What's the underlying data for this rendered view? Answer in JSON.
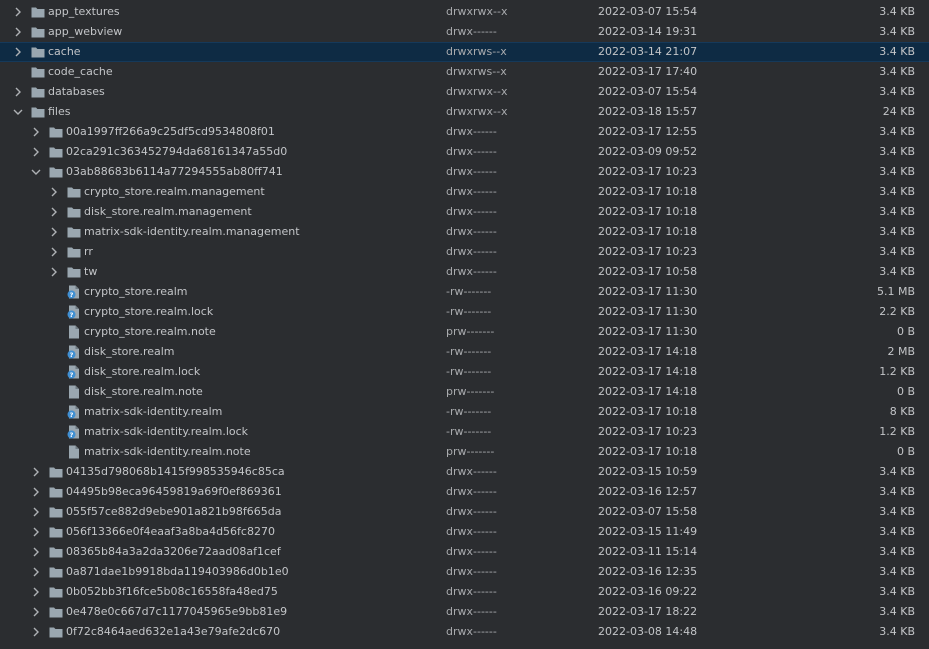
{
  "theme": {
    "background": "#2b2d30",
    "selection": "#0e2b44",
    "folder_color": "#9aa7b0",
    "file_color": "#9aa7b0",
    "unknown_badge": "#3f8fd2"
  },
  "rows": [
    {
      "depth": 0,
      "type": "folder",
      "arrow": "right",
      "name": "app_textures",
      "perm": "drwxrwx--x",
      "date": "2022-03-07 15:54",
      "size": "3.4 KB"
    },
    {
      "depth": 0,
      "type": "folder",
      "arrow": "right",
      "name": "app_webview",
      "perm": "drwx------",
      "date": "2022-03-14 19:31",
      "size": "3.4 KB"
    },
    {
      "depth": 0,
      "type": "folder",
      "arrow": "right",
      "name": "cache",
      "perm": "drwxrws--x",
      "date": "2022-03-14 21:07",
      "size": "3.4 KB",
      "selected": true
    },
    {
      "depth": 0,
      "type": "folder",
      "arrow": "none",
      "name": "code_cache",
      "perm": "drwxrws--x",
      "date": "2022-03-17 17:40",
      "size": "3.4 KB"
    },
    {
      "depth": 0,
      "type": "folder",
      "arrow": "right",
      "name": "databases",
      "perm": "drwxrwx--x",
      "date": "2022-03-07 15:54",
      "size": "3.4 KB"
    },
    {
      "depth": 0,
      "type": "folder",
      "arrow": "down",
      "name": "files",
      "perm": "drwxrwx--x",
      "date": "2022-03-18 15:57",
      "size": "24 KB"
    },
    {
      "depth": 1,
      "type": "folder",
      "arrow": "right",
      "name": "00a1997ff266a9c25df5cd9534808f01",
      "perm": "drwx------",
      "date": "2022-03-17 12:55",
      "size": "3.4 KB"
    },
    {
      "depth": 1,
      "type": "folder",
      "arrow": "right",
      "name": "02ca291c363452794da68161347a55d0",
      "perm": "drwx------",
      "date": "2022-03-09 09:52",
      "size": "3.4 KB"
    },
    {
      "depth": 1,
      "type": "folder",
      "arrow": "down",
      "name": "03ab88683b6114a77294555ab80ff741",
      "perm": "drwx------",
      "date": "2022-03-17 10:23",
      "size": "3.4 KB"
    },
    {
      "depth": 2,
      "type": "folder",
      "arrow": "right",
      "name": "crypto_store.realm.management",
      "perm": "drwx------",
      "date": "2022-03-17 10:18",
      "size": "3.4 KB"
    },
    {
      "depth": 2,
      "type": "folder",
      "arrow": "right",
      "name": "disk_store.realm.management",
      "perm": "drwx------",
      "date": "2022-03-17 10:18",
      "size": "3.4 KB"
    },
    {
      "depth": 2,
      "type": "folder",
      "arrow": "right",
      "name": "matrix-sdk-identity.realm.management",
      "perm": "drwx------",
      "date": "2022-03-17 10:18",
      "size": "3.4 KB"
    },
    {
      "depth": 2,
      "type": "folder",
      "arrow": "right",
      "name": "rr",
      "perm": "drwx------",
      "date": "2022-03-17 10:23",
      "size": "3.4 KB"
    },
    {
      "depth": 2,
      "type": "folder",
      "arrow": "right",
      "name": "tw",
      "perm": "drwx------",
      "date": "2022-03-17 10:58",
      "size": "3.4 KB"
    },
    {
      "depth": 2,
      "type": "unknown",
      "arrow": "none",
      "name": "crypto_store.realm",
      "perm": "-rw-------",
      "date": "2022-03-17 11:30",
      "size": "5.1 MB"
    },
    {
      "depth": 2,
      "type": "unknown",
      "arrow": "none",
      "name": "crypto_store.realm.lock",
      "perm": "-rw-------",
      "date": "2022-03-17 11:30",
      "size": "2.2 KB"
    },
    {
      "depth": 2,
      "type": "file",
      "arrow": "none",
      "name": "crypto_store.realm.note",
      "perm": "prw-------",
      "date": "2022-03-17 11:30",
      "size": "0 B"
    },
    {
      "depth": 2,
      "type": "unknown",
      "arrow": "none",
      "name": "disk_store.realm",
      "perm": "-rw-------",
      "date": "2022-03-17 14:18",
      "size": "2 MB"
    },
    {
      "depth": 2,
      "type": "unknown",
      "arrow": "none",
      "name": "disk_store.realm.lock",
      "perm": "-rw-------",
      "date": "2022-03-17 14:18",
      "size": "1.2 KB"
    },
    {
      "depth": 2,
      "type": "file",
      "arrow": "none",
      "name": "disk_store.realm.note",
      "perm": "prw-------",
      "date": "2022-03-17 14:18",
      "size": "0 B"
    },
    {
      "depth": 2,
      "type": "unknown",
      "arrow": "none",
      "name": "matrix-sdk-identity.realm",
      "perm": "-rw-------",
      "date": "2022-03-17 10:18",
      "size": "8 KB"
    },
    {
      "depth": 2,
      "type": "unknown",
      "arrow": "none",
      "name": "matrix-sdk-identity.realm.lock",
      "perm": "-rw-------",
      "date": "2022-03-17 10:23",
      "size": "1.2 KB"
    },
    {
      "depth": 2,
      "type": "file",
      "arrow": "none",
      "name": "matrix-sdk-identity.realm.note",
      "perm": "prw-------",
      "date": "2022-03-17 10:18",
      "size": "0 B"
    },
    {
      "depth": 1,
      "type": "folder",
      "arrow": "right",
      "name": "04135d798068b1415f998535946c85ca",
      "perm": "drwx------",
      "date": "2022-03-15 10:59",
      "size": "3.4 KB"
    },
    {
      "depth": 1,
      "type": "folder",
      "arrow": "right",
      "name": "04495b98eca96459819a69f0ef869361",
      "perm": "drwx------",
      "date": "2022-03-16 12:57",
      "size": "3.4 KB"
    },
    {
      "depth": 1,
      "type": "folder",
      "arrow": "right",
      "name": "055f57ce882d9ebe901a821b98f665da",
      "perm": "drwx------",
      "date": "2022-03-07 15:58",
      "size": "3.4 KB"
    },
    {
      "depth": 1,
      "type": "folder",
      "arrow": "right",
      "name": "056f13366e0f4eaaf3a8ba4d56fc8270",
      "perm": "drwx------",
      "date": "2022-03-15 11:49",
      "size": "3.4 KB"
    },
    {
      "depth": 1,
      "type": "folder",
      "arrow": "right",
      "name": "08365b84a3a2da3206e72aad08af1cef",
      "perm": "drwx------",
      "date": "2022-03-11 15:14",
      "size": "3.4 KB"
    },
    {
      "depth": 1,
      "type": "folder",
      "arrow": "right",
      "name": "0a871dae1b9918bda119403986d0b1e0",
      "perm": "drwx------",
      "date": "2022-03-16 12:35",
      "size": "3.4 KB"
    },
    {
      "depth": 1,
      "type": "folder",
      "arrow": "right",
      "name": "0b052bb3f16fce5b08c16558fa48ed75",
      "perm": "drwx------",
      "date": "2022-03-16 09:22",
      "size": "3.4 KB"
    },
    {
      "depth": 1,
      "type": "folder",
      "arrow": "right",
      "name": "0e478e0c667d7c1177045965e9bb81e9",
      "perm": "drwx------",
      "date": "2022-03-17 18:22",
      "size": "3.4 KB"
    },
    {
      "depth": 1,
      "type": "folder",
      "arrow": "right",
      "name": "0f72c8464aed632e1a43e79afe2dc670",
      "perm": "drwx------",
      "date": "2022-03-08 14:48",
      "size": "3.4 KB"
    }
  ]
}
